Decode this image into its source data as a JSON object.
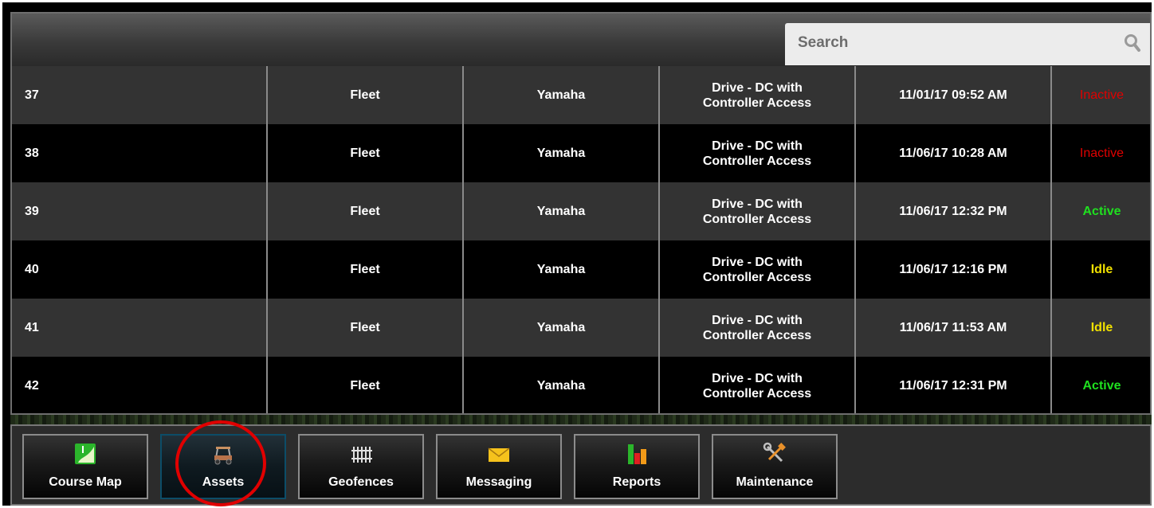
{
  "search": {
    "placeholder": "Search",
    "icon": "search-icon"
  },
  "rows": [
    {
      "id": "37",
      "group": "Fleet",
      "make": "Yamaha",
      "mode_line1": "Drive - DC with",
      "mode_line2": "Controller Access",
      "last_update": "11/01/17 09:52 AM",
      "status": "Inactive"
    },
    {
      "id": "38",
      "group": "Fleet",
      "make": "Yamaha",
      "mode_line1": "Drive - DC with",
      "mode_line2": "Controller Access",
      "last_update": "11/06/17 10:28 AM",
      "status": "Inactive"
    },
    {
      "id": "39",
      "group": "Fleet",
      "make": "Yamaha",
      "mode_line1": "Drive - DC with",
      "mode_line2": "Controller Access",
      "last_update": "11/06/17 12:32 PM",
      "status": "Active"
    },
    {
      "id": "40",
      "group": "Fleet",
      "make": "Yamaha",
      "mode_line1": "Drive - DC with",
      "mode_line2": "Controller Access",
      "last_update": "11/06/17 12:16 PM",
      "status": "Idle"
    },
    {
      "id": "41",
      "group": "Fleet",
      "make": "Yamaha",
      "mode_line1": "Drive - DC with",
      "mode_line2": "Controller Access",
      "last_update": "11/06/17 11:53 AM",
      "status": "Idle"
    },
    {
      "id": "42",
      "group": "Fleet",
      "make": "Yamaha",
      "mode_line1": "Drive - DC with",
      "mode_line2": "Controller Access",
      "last_update": "11/06/17 12:31 PM",
      "status": "Active"
    }
  ],
  "status_colors": {
    "Inactive": "#e00000",
    "Active": "#1fe01f",
    "Idle": "#f0e000"
  },
  "toolbar": {
    "selected": "Assets",
    "buttons": [
      {
        "label": "Course Map",
        "icon": "course-map-icon"
      },
      {
        "label": "Assets",
        "icon": "golf-cart-icon"
      },
      {
        "label": "Geofences",
        "icon": "fence-icon"
      },
      {
        "label": "Messaging",
        "icon": "envelope-icon"
      },
      {
        "label": "Reports",
        "icon": "bar-chart-icon"
      },
      {
        "label": "Maintenance",
        "icon": "tools-icon"
      }
    ]
  },
  "annotation": {
    "highlight": "Assets",
    "color": "#e00000"
  }
}
